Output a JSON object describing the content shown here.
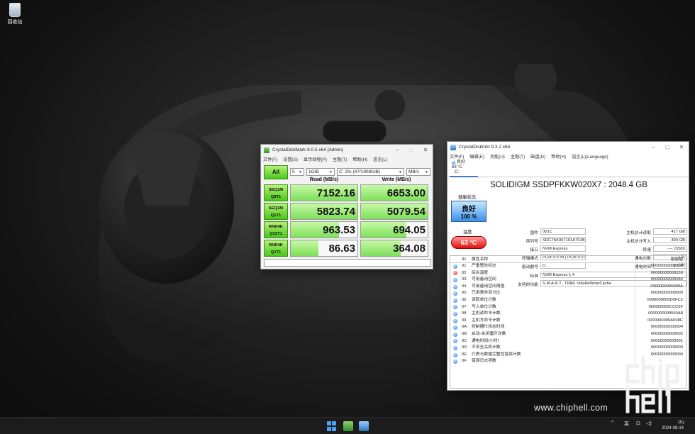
{
  "desktop": {
    "recycle_bin_label": "回收站"
  },
  "cdm": {
    "title": "CrystalDiskMark 8.0.5 x64 [Admin]",
    "menu": [
      "文件(F)",
      "设置(S)",
      "显示线程(P)",
      "主题(T)",
      "帮助(H)",
      "语言(L)"
    ],
    "all_label": "All",
    "count": "5",
    "size": "1GiB",
    "drive": "C: 2% (47/1908GiB)",
    "unit": "MB/s",
    "read_header": "Read (MB/s)",
    "write_header": "Write (MB/s)",
    "rows": [
      {
        "l1": "SEQ1M",
        "l2": "Q8T1",
        "read": "7152.16",
        "write": "6653.00",
        "read_frac": 1.0,
        "write_frac": 1.0
      },
      {
        "l1": "SEQ1M",
        "l2": "Q1T1",
        "read": "5823.74",
        "write": "5079.54",
        "read_frac": 1.0,
        "write_frac": 1.0
      },
      {
        "l1": "RND4K",
        "l2": "Q32T1",
        "read": "963.53",
        "write": "694.05",
        "read_frac": 0.72,
        "write_frac": 0.68
      },
      {
        "l1": "RND4K",
        "l2": "Q1T1",
        "read": "86.63",
        "write": "364.08",
        "read_frac": 0.42,
        "write_frac": 0.6
      }
    ]
  },
  "cdi": {
    "title": "CrystalDiskInfo 9.3.2 x64",
    "menu": [
      "文件(F)",
      "编辑(E)",
      "功能(U)",
      "主题(T)",
      "磁盘(D)",
      "帮助(H)",
      "语言(L)(Language)"
    ],
    "tab": {
      "status": "良好",
      "temp": "63 °C",
      "drive": "C:"
    },
    "model": "SOLIDIGM SSDPFKKW020X7 : 2048.4 GB",
    "health_label": "健康状态",
    "health_status": "良好",
    "health_percent": "100 %",
    "temp_label": "温度",
    "temp_value": "63 °C",
    "fields_left": [
      {
        "k": "固件",
        "v": "001C"
      },
      {
        "k": "序列号",
        "v": "SDC7N4367101A791B"
      },
      {
        "k": "接口",
        "v": "NVM Express"
      },
      {
        "k": "传输模式",
        "v": "PCIe 4.0 x4 | PCIe 4.0 x4"
      },
      {
        "k": "驱动器号",
        "v": "C:"
      }
    ],
    "fields_right": [
      {
        "k": "主机总计读取",
        "v": "417 GB"
      },
      {
        "k": "主机总计写入",
        "v": "399 GB"
      },
      {
        "k": "转速",
        "v": "---- (SSD)"
      },
      {
        "k": "通电次数",
        "v": "2 次"
      },
      {
        "k": "通电时间",
        "v": "1 小时"
      }
    ],
    "standard_label": "标准",
    "standard_value": "NVM Express 1.4",
    "features_label": "支持的功能",
    "features_value": "S.M.A.R.T., TRIM, VolatileWriteCache",
    "smart_headers": {
      "id": "ID",
      "name": "属性名称",
      "raw": "原始值"
    },
    "smart": [
      {
        "id": "01",
        "name": "严重警告标志",
        "raw": "00000000000000",
        "status": "good"
      },
      {
        "id": "02",
        "name": "综合温度",
        "raw": "00000000000150",
        "status": "bad"
      },
      {
        "id": "03",
        "name": "可用备用空间",
        "raw": "00000000000064",
        "status": "good"
      },
      {
        "id": "04",
        "name": "可用备用空间阈值",
        "raw": "0000000000000A",
        "status": "good"
      },
      {
        "id": "05",
        "name": "已用寿命百分比",
        "raw": "00000000000000",
        "status": "good"
      },
      {
        "id": "06",
        "name": "读取单位计数",
        "raw": "0000000000D5FC2",
        "status": "good"
      },
      {
        "id": "07",
        "name": "写入单位计数",
        "raw": "000000000CCC6F",
        "status": "good"
      },
      {
        "id": "08",
        "name": "主机读命令计数",
        "raw": "0000000009560A8",
        "status": "good"
      },
      {
        "id": "09",
        "name": "主机写命令计数",
        "raw": "0000000009A008C",
        "status": "good"
      },
      {
        "id": "0A",
        "name": "控制器忙状态时间",
        "raw": "00000000000004",
        "status": "good"
      },
      {
        "id": "0B",
        "name": "启动-关闭循环次数",
        "raw": "00000000000002",
        "status": "good"
      },
      {
        "id": "0C",
        "name": "通电时间(小时)",
        "raw": "00000000000001",
        "status": "good"
      },
      {
        "id": "0D",
        "name": "不安全关机计数",
        "raw": "00000000000000",
        "status": "good"
      },
      {
        "id": "0E",
        "name": "介质与数据完整性错误计数",
        "raw": "00000000000000",
        "status": "good"
      },
      {
        "id": "0F",
        "name": "错误日志项数",
        "raw": "",
        "status": "good"
      }
    ]
  },
  "taskbar": {
    "ime": "英",
    "time": "10:",
    "date": "2024-08-14"
  },
  "watermark": {
    "url": "www.chiphell.com",
    "logo_text": "chip hell"
  },
  "colors": {
    "accent_green": "#48c818",
    "health_blue": "#3a90e8",
    "temp_red": "#e31010"
  }
}
